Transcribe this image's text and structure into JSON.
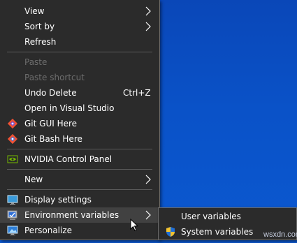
{
  "context_menu": {
    "items": [
      {
        "label": "View",
        "submenu": true
      },
      {
        "label": "Sort by",
        "submenu": true
      },
      {
        "label": "Refresh"
      },
      {
        "label": "Paste",
        "disabled": true
      },
      {
        "label": "Paste shortcut",
        "disabled": true
      },
      {
        "label": "Undo Delete",
        "shortcut": "Ctrl+Z"
      },
      {
        "label": "Open in Visual Studio"
      },
      {
        "label": "Git GUI Here",
        "icon": "git-gui-icon"
      },
      {
        "label": "Git Bash Here",
        "icon": "git-bash-icon"
      },
      {
        "label": "NVIDIA Control Panel",
        "icon": "nvidia-icon"
      },
      {
        "label": "New",
        "submenu": true
      },
      {
        "label": "Display settings",
        "icon": "display-settings-icon"
      },
      {
        "label": "Environment variables",
        "icon": "environment-variables-icon",
        "submenu": true,
        "highlighted": true
      },
      {
        "label": "Personalize",
        "icon": "personalize-icon"
      }
    ]
  },
  "submenu": {
    "items": [
      {
        "label": "User variables"
      },
      {
        "label": "System variables",
        "icon": "uac-shield-icon"
      }
    ]
  },
  "watermark": "wsxdn.com",
  "colors": {
    "menu_background": "#2b2b2b",
    "menu_text": "#ffffff",
    "disabled_text": "#6d6d6d",
    "highlight": "#414141",
    "desktop_blue": "#0a52c8"
  }
}
